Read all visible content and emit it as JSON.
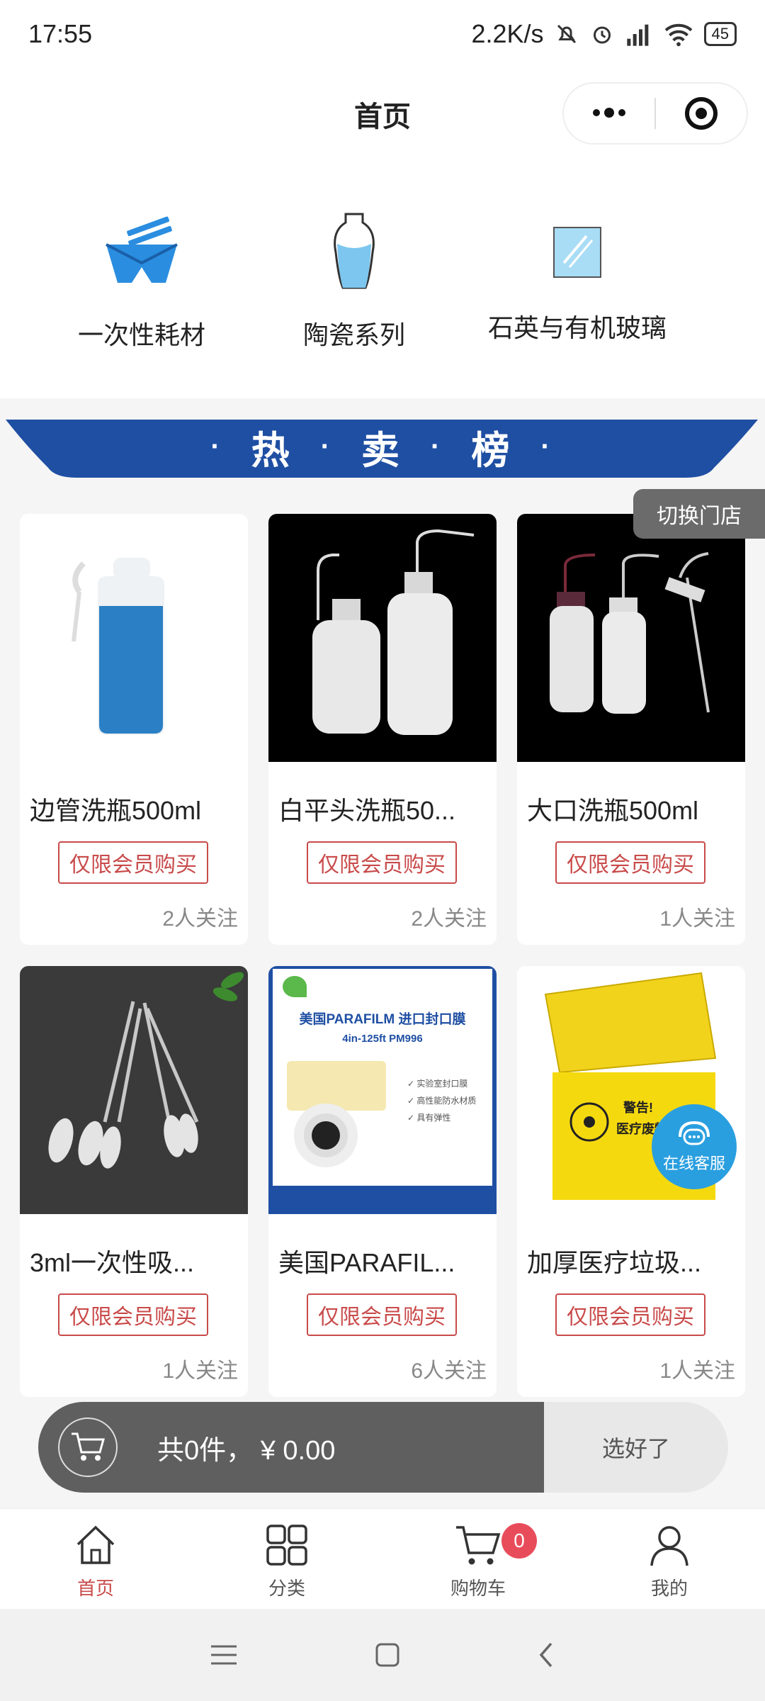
{
  "status": {
    "time": "17:55",
    "speed": "2.2K/s",
    "battery": "45"
  },
  "header": {
    "title": "首页"
  },
  "categories": [
    {
      "label": "一次性耗材"
    },
    {
      "label": "陶瓷系列"
    },
    {
      "label": "石英与有机玻璃"
    }
  ],
  "banner": {
    "word1": "热",
    "word2": "卖",
    "word3": "榜"
  },
  "store_switch": "切换门店",
  "member_label": "仅限会员购买",
  "products": [
    {
      "name": "边管洗瓶500ml",
      "follow": "2人关注"
    },
    {
      "name": "白平头洗瓶50...",
      "follow": "2人关注"
    },
    {
      "name": "大口洗瓶500ml",
      "follow": "1人关注"
    },
    {
      "name": "3ml一次性吸...",
      "follow": "1人关注"
    },
    {
      "name": "美国PARAFIL...",
      "follow": "6人关注"
    },
    {
      "name": "加厚医疗垃圾...",
      "follow": "1人关注"
    }
  ],
  "parafilm": {
    "title": "美国PARAFILM 进口封口膜",
    "spec": "4in-125ft   PM996",
    "f1": "实验室封口膜",
    "f2": "高性能防水材质",
    "f3": "具有弹性"
  },
  "biohazard": {
    "warn": "警告!",
    "sub": "医疗废物"
  },
  "customer_service": "在线客服",
  "cart": {
    "total": "共0件，  ¥ 0.00",
    "confirm": "选好了"
  },
  "tabs": [
    {
      "label": "首页"
    },
    {
      "label": "分类"
    },
    {
      "label": "购物车",
      "badge": "0"
    },
    {
      "label": "我的"
    }
  ]
}
